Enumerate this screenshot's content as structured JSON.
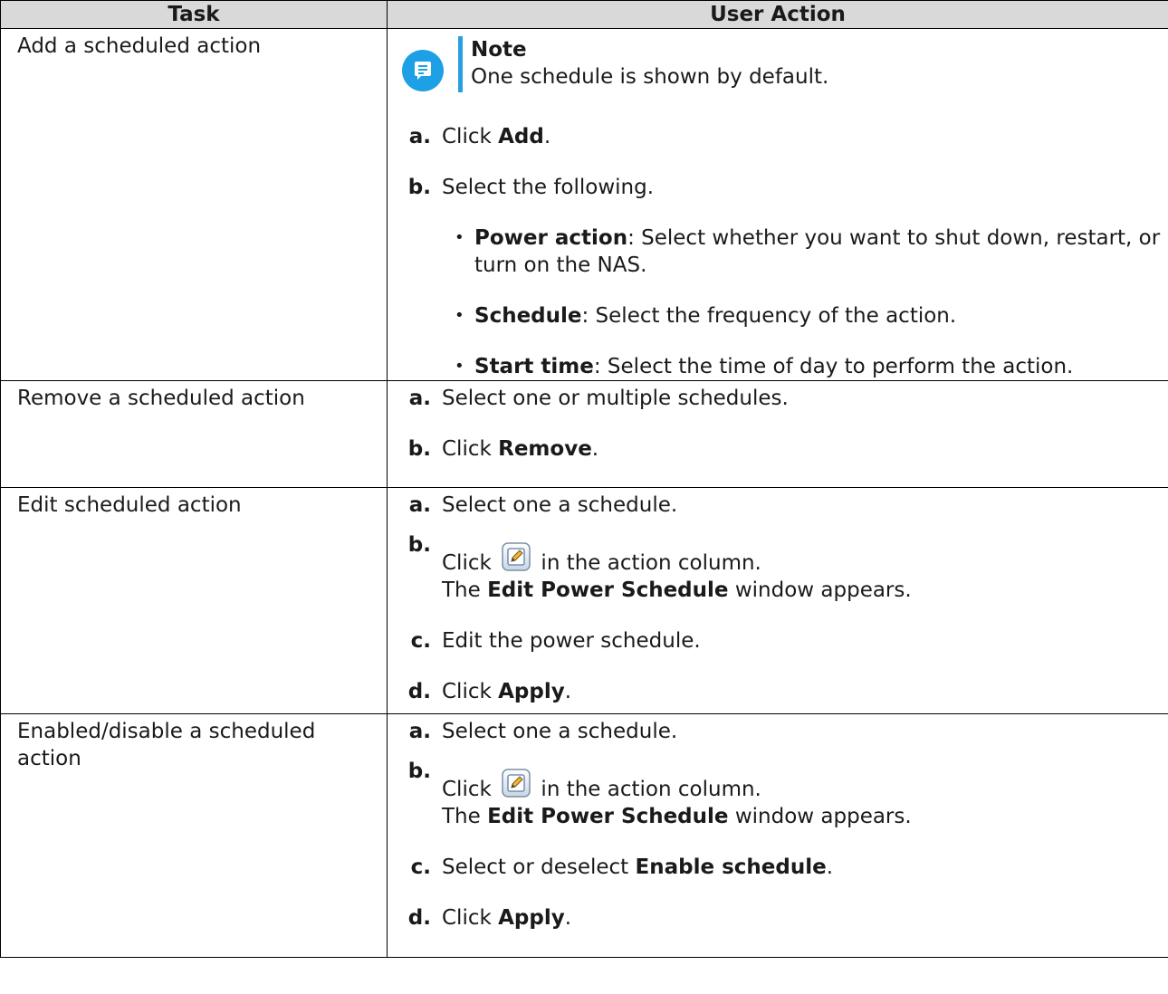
{
  "table": {
    "headers": {
      "task": "Task",
      "action": "User Action"
    },
    "rows": [
      {
        "task": "Add a scheduled action",
        "note": {
          "title": "Note",
          "text": "One schedule is shown by default."
        },
        "steps": {
          "a": {
            "label": "a.",
            "pre": "Click ",
            "bold": "Add",
            "post": "."
          },
          "b": {
            "label": "b.",
            "text": "Select the following."
          }
        },
        "bullets": [
          {
            "bold": "Power action",
            "text": ": Select whether you want to shut down, restart, or turn on the NAS."
          },
          {
            "bold": "Schedule",
            "text": ": Select the frequency of the action."
          },
          {
            "bold": "Start time",
            "text": ": Select the time of day to perform the action."
          }
        ]
      },
      {
        "task": "Remove a scheduled action",
        "steps": {
          "a": {
            "label": "a.",
            "text": "Select one or multiple schedules."
          },
          "b": {
            "label": "b.",
            "pre": "Click ",
            "bold": "Remove",
            "post": "."
          }
        }
      },
      {
        "task": "Edit scheduled action",
        "steps": {
          "a": {
            "label": "a.",
            "text": "Select one a schedule."
          },
          "b": {
            "label": "b.",
            "pre": "Click ",
            "post": " in the action column.",
            "line2_pre": "The ",
            "line2_bold": "Edit Power Schedule",
            "line2_post": " window appears."
          },
          "c": {
            "label": "c.",
            "text": "Edit the power schedule."
          },
          "d": {
            "label": "d.",
            "pre": "Click ",
            "bold": "Apply",
            "post": "."
          }
        }
      },
      {
        "task": "Enabled/disable a scheduled action",
        "steps": {
          "a": {
            "label": "a.",
            "text": "Select one a schedule."
          },
          "b": {
            "label": "b.",
            "pre": "Click ",
            "post": " in the action column.",
            "line2_pre": "The ",
            "line2_bold": "Edit Power Schedule",
            "line2_post": " window appears."
          },
          "c": {
            "label": "c.",
            "pre": "Select or deselect ",
            "bold": "Enable schedule",
            "post": "."
          },
          "d": {
            "label": "d.",
            "pre": "Click ",
            "bold": "Apply",
            "post": "."
          }
        }
      }
    ]
  },
  "icons": {
    "note": "note-icon",
    "edit": "edit-pencil-icon"
  },
  "colors": {
    "header_bg": "#d9d9d9",
    "note_accent": "#1ea0e6"
  }
}
